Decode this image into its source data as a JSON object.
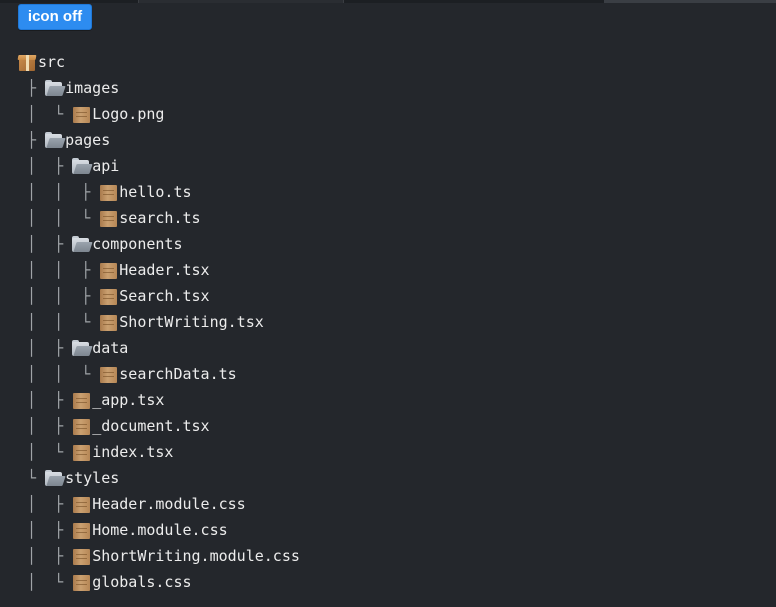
{
  "toolbar": {
    "icon_toggle_label": "icon off"
  },
  "tree": {
    "rows": [
      {
        "guide": "",
        "icon": "package-icon",
        "name": "src"
      },
      {
        "guide": " ├ ",
        "icon": "folder-icon",
        "name": "images"
      },
      {
        "guide": " │  └ ",
        "icon": "file-icon",
        "name": "Logo.png"
      },
      {
        "guide": " ├ ",
        "icon": "folder-icon",
        "name": "pages"
      },
      {
        "guide": " │  ├ ",
        "icon": "folder-icon",
        "name": "api"
      },
      {
        "guide": " │  │  ├ ",
        "icon": "file-icon",
        "name": "hello.ts"
      },
      {
        "guide": " │  │  └ ",
        "icon": "file-icon",
        "name": "search.ts"
      },
      {
        "guide": " │  ├ ",
        "icon": "folder-icon",
        "name": "components"
      },
      {
        "guide": " │  │  ├ ",
        "icon": "file-icon",
        "name": "Header.tsx"
      },
      {
        "guide": " │  │  ├ ",
        "icon": "file-icon",
        "name": "Search.tsx"
      },
      {
        "guide": " │  │  └ ",
        "icon": "file-icon",
        "name": "ShortWriting.tsx"
      },
      {
        "guide": " │  ├ ",
        "icon": "folder-icon",
        "name": "data"
      },
      {
        "guide": " │  │  └ ",
        "icon": "file-icon",
        "name": "searchData.ts"
      },
      {
        "guide": " │  ├ ",
        "icon": "file-icon",
        "name": "_app.tsx"
      },
      {
        "guide": " │  ├ ",
        "icon": "file-icon",
        "name": "_document.tsx"
      },
      {
        "guide": " │  └ ",
        "icon": "file-icon",
        "name": "index.tsx"
      },
      {
        "guide": " └ ",
        "icon": "folder-icon",
        "name": "styles"
      },
      {
        "guide": " │  ├ ",
        "icon": "file-icon",
        "name": "Header.module.css"
      },
      {
        "guide": " │  ├ ",
        "icon": "file-icon",
        "name": "Home.module.css"
      },
      {
        "guide": " │  ├ ",
        "icon": "file-icon",
        "name": "ShortWriting.module.css"
      },
      {
        "guide": " │  └ ",
        "icon": "file-icon",
        "name": "globals.css"
      }
    ]
  }
}
